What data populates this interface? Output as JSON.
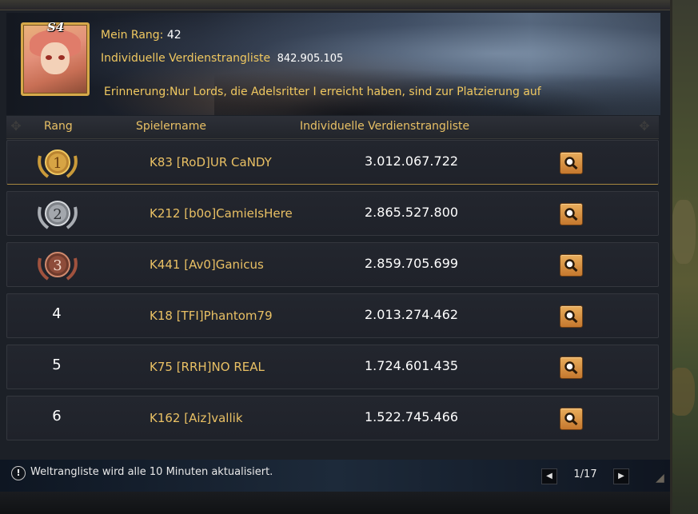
{
  "header": {
    "season_badge": "S4",
    "my_rank_label": "Mein Rang:",
    "my_rank_value": "42",
    "score_label": "Individuelle Verdienstrangliste",
    "score_value": "842.905.105",
    "reminder": "Erinnerung:Nur Lords, die Adelsritter I erreicht haben, sind zur Platzierung auf"
  },
  "table": {
    "columns": [
      "Rang",
      "Spielername",
      "Individuelle Verdienstrangliste"
    ],
    "rows": [
      {
        "rank": "1",
        "medal": "gold",
        "player": "K83 [RoD]UR CaNDY",
        "score": "3.012.067.722"
      },
      {
        "rank": "2",
        "medal": "silver",
        "player": "K212 [b0o]CamieIsHere",
        "score": "2.865.527.800"
      },
      {
        "rank": "3",
        "medal": "bronze",
        "player": "K441 [Av0]Ganicus",
        "score": "2.859.705.699"
      },
      {
        "rank": "4",
        "medal": null,
        "player": "K18 [TFI]Phantom79",
        "score": "2.013.274.462"
      },
      {
        "rank": "5",
        "medal": null,
        "player": "K75 [RRH]NO REAL",
        "score": "1.724.601.435"
      },
      {
        "rank": "6",
        "medal": null,
        "player": "K162 [Aiz]vallik",
        "score": "1.522.745.466"
      }
    ]
  },
  "footer": {
    "notice_icon": "!",
    "notice": "Weltrangliste wird alle 10 Minuten aktualisiert.",
    "page": "1/17"
  },
  "colors": {
    "gold_text": "#f0c860",
    "accent_button": "#d98f3f",
    "medal_gold": "#c99a3a",
    "medal_silver": "#a9adb3",
    "medal_bronze": "#a0523e"
  },
  "icons": {
    "search": "magnifier-icon",
    "prev": "triangle-left-icon",
    "next": "triangle-right-icon"
  }
}
